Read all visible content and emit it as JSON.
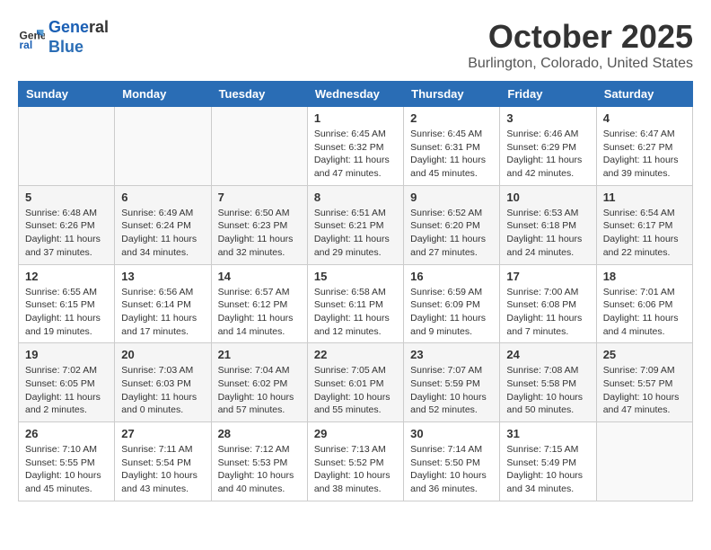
{
  "header": {
    "logo_line1": "General",
    "logo_line2": "Blue",
    "month_title": "October 2025",
    "location": "Burlington, Colorado, United States"
  },
  "weekdays": [
    "Sunday",
    "Monday",
    "Tuesday",
    "Wednesday",
    "Thursday",
    "Friday",
    "Saturday"
  ],
  "weeks": [
    [
      {
        "day": "",
        "info": ""
      },
      {
        "day": "",
        "info": ""
      },
      {
        "day": "",
        "info": ""
      },
      {
        "day": "1",
        "info": "Sunrise: 6:45 AM\nSunset: 6:32 PM\nDaylight: 11 hours\nand 47 minutes."
      },
      {
        "day": "2",
        "info": "Sunrise: 6:45 AM\nSunset: 6:31 PM\nDaylight: 11 hours\nand 45 minutes."
      },
      {
        "day": "3",
        "info": "Sunrise: 6:46 AM\nSunset: 6:29 PM\nDaylight: 11 hours\nand 42 minutes."
      },
      {
        "day": "4",
        "info": "Sunrise: 6:47 AM\nSunset: 6:27 PM\nDaylight: 11 hours\nand 39 minutes."
      }
    ],
    [
      {
        "day": "5",
        "info": "Sunrise: 6:48 AM\nSunset: 6:26 PM\nDaylight: 11 hours\nand 37 minutes."
      },
      {
        "day": "6",
        "info": "Sunrise: 6:49 AM\nSunset: 6:24 PM\nDaylight: 11 hours\nand 34 minutes."
      },
      {
        "day": "7",
        "info": "Sunrise: 6:50 AM\nSunset: 6:23 PM\nDaylight: 11 hours\nand 32 minutes."
      },
      {
        "day": "8",
        "info": "Sunrise: 6:51 AM\nSunset: 6:21 PM\nDaylight: 11 hours\nand 29 minutes."
      },
      {
        "day": "9",
        "info": "Sunrise: 6:52 AM\nSunset: 6:20 PM\nDaylight: 11 hours\nand 27 minutes."
      },
      {
        "day": "10",
        "info": "Sunrise: 6:53 AM\nSunset: 6:18 PM\nDaylight: 11 hours\nand 24 minutes."
      },
      {
        "day": "11",
        "info": "Sunrise: 6:54 AM\nSunset: 6:17 PM\nDaylight: 11 hours\nand 22 minutes."
      }
    ],
    [
      {
        "day": "12",
        "info": "Sunrise: 6:55 AM\nSunset: 6:15 PM\nDaylight: 11 hours\nand 19 minutes."
      },
      {
        "day": "13",
        "info": "Sunrise: 6:56 AM\nSunset: 6:14 PM\nDaylight: 11 hours\nand 17 minutes."
      },
      {
        "day": "14",
        "info": "Sunrise: 6:57 AM\nSunset: 6:12 PM\nDaylight: 11 hours\nand 14 minutes."
      },
      {
        "day": "15",
        "info": "Sunrise: 6:58 AM\nSunset: 6:11 PM\nDaylight: 11 hours\nand 12 minutes."
      },
      {
        "day": "16",
        "info": "Sunrise: 6:59 AM\nSunset: 6:09 PM\nDaylight: 11 hours\nand 9 minutes."
      },
      {
        "day": "17",
        "info": "Sunrise: 7:00 AM\nSunset: 6:08 PM\nDaylight: 11 hours\nand 7 minutes."
      },
      {
        "day": "18",
        "info": "Sunrise: 7:01 AM\nSunset: 6:06 PM\nDaylight: 11 hours\nand 4 minutes."
      }
    ],
    [
      {
        "day": "19",
        "info": "Sunrise: 7:02 AM\nSunset: 6:05 PM\nDaylight: 11 hours\nand 2 minutes."
      },
      {
        "day": "20",
        "info": "Sunrise: 7:03 AM\nSunset: 6:03 PM\nDaylight: 11 hours\nand 0 minutes."
      },
      {
        "day": "21",
        "info": "Sunrise: 7:04 AM\nSunset: 6:02 PM\nDaylight: 10 hours\nand 57 minutes."
      },
      {
        "day": "22",
        "info": "Sunrise: 7:05 AM\nSunset: 6:01 PM\nDaylight: 10 hours\nand 55 minutes."
      },
      {
        "day": "23",
        "info": "Sunrise: 7:07 AM\nSunset: 5:59 PM\nDaylight: 10 hours\nand 52 minutes."
      },
      {
        "day": "24",
        "info": "Sunrise: 7:08 AM\nSunset: 5:58 PM\nDaylight: 10 hours\nand 50 minutes."
      },
      {
        "day": "25",
        "info": "Sunrise: 7:09 AM\nSunset: 5:57 PM\nDaylight: 10 hours\nand 47 minutes."
      }
    ],
    [
      {
        "day": "26",
        "info": "Sunrise: 7:10 AM\nSunset: 5:55 PM\nDaylight: 10 hours\nand 45 minutes."
      },
      {
        "day": "27",
        "info": "Sunrise: 7:11 AM\nSunset: 5:54 PM\nDaylight: 10 hours\nand 43 minutes."
      },
      {
        "day": "28",
        "info": "Sunrise: 7:12 AM\nSunset: 5:53 PM\nDaylight: 10 hours\nand 40 minutes."
      },
      {
        "day": "29",
        "info": "Sunrise: 7:13 AM\nSunset: 5:52 PM\nDaylight: 10 hours\nand 38 minutes."
      },
      {
        "day": "30",
        "info": "Sunrise: 7:14 AM\nSunset: 5:50 PM\nDaylight: 10 hours\nand 36 minutes."
      },
      {
        "day": "31",
        "info": "Sunrise: 7:15 AM\nSunset: 5:49 PM\nDaylight: 10 hours\nand 34 minutes."
      },
      {
        "day": "",
        "info": ""
      }
    ]
  ]
}
